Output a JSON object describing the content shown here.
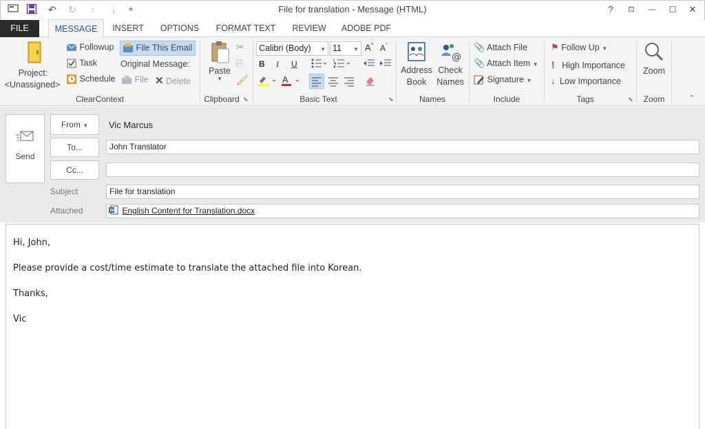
{
  "window": {
    "title": "File for translation - Message (HTML)",
    "help": "?",
    "restore_ribbon": "⊡",
    "minimize": "—",
    "maximize": "☐",
    "close": "✕"
  },
  "tabs": [
    {
      "label": "FILE"
    },
    {
      "label": "MESSAGE"
    },
    {
      "label": "INSERT"
    },
    {
      "label": "OPTIONS"
    },
    {
      "label": "FORMAT TEXT"
    },
    {
      "label": "REVIEW"
    },
    {
      "label": "ADOBE PDF"
    }
  ],
  "ribbon": {
    "clearcontext": {
      "project_line1": "Project:",
      "project_line2": "<Unassigned>",
      "followup": "Followup",
      "task": "Task",
      "schedule": "Schedule",
      "file_this_email": "File This Email",
      "original_message": "Original Message:",
      "file": "File",
      "delete": "Delete",
      "group": "ClearContext"
    },
    "clipboard": {
      "paste": "Paste",
      "group": "Clipboard"
    },
    "basic_text": {
      "font": "Calibri (Body)",
      "size": "11",
      "bold": "B",
      "italic": "I",
      "underline": "U",
      "group": "Basic Text"
    },
    "names": {
      "address_book_1": "Address",
      "address_book_2": "Book",
      "check_names_1": "Check",
      "check_names_2": "Names",
      "group": "Names"
    },
    "include": {
      "attach_file": "Attach File",
      "attach_item": "Attach Item",
      "signature": "Signature",
      "group": "Include"
    },
    "tags": {
      "follow_up": "Follow Up",
      "high": "High Importance",
      "low": "Low Importance",
      "group": "Tags"
    },
    "zoom": {
      "zoom": "Zoom",
      "group": "Zoom"
    }
  },
  "compose": {
    "send": "Send",
    "from_label": "From",
    "from_value": "Vic Marcus",
    "to_label": "To...",
    "to_value": "John Translator",
    "cc_label": "Cc...",
    "cc_value": "",
    "subject_label": "Subject",
    "subject_value": "File for translation",
    "attached_label": "Attached",
    "attachment": "English Content for Translation.docx"
  },
  "body": {
    "greeting": "Hi, John,",
    "line1": "Please provide a cost/time estimate to translate the attached file into Korean.",
    "closing": "Thanks,",
    "signature": "Vic"
  },
  "colors": {
    "accent": "#2b579a",
    "file_tab": "#2b2b2b",
    "ribbon_bg": "#f3f3f3",
    "header_bg": "#eaeaea"
  }
}
